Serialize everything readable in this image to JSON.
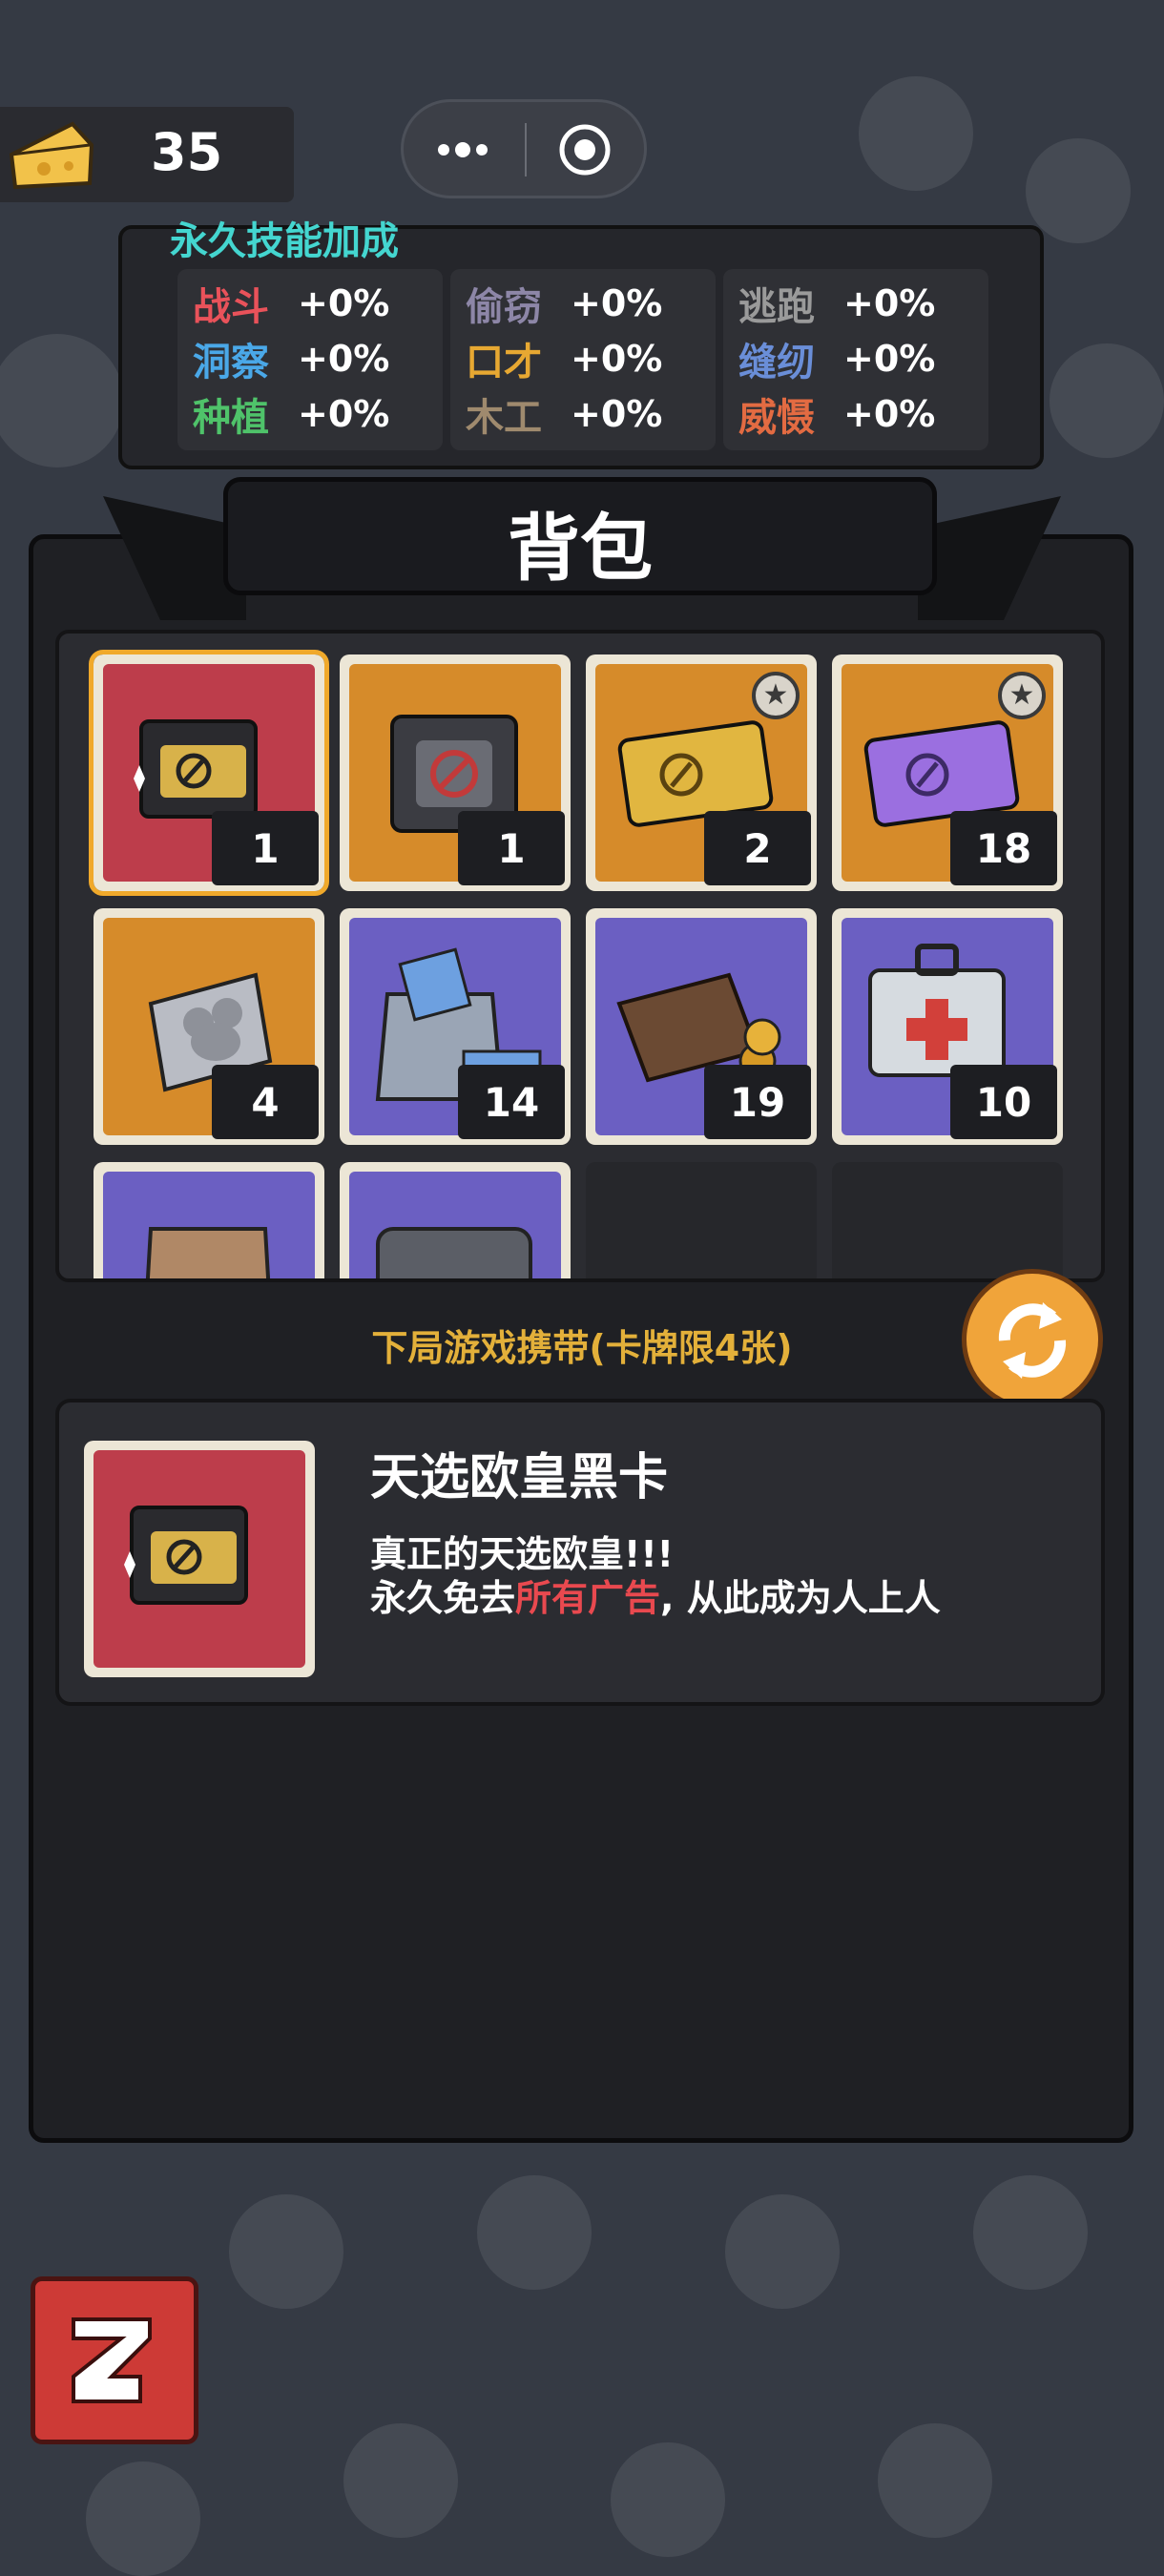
{
  "currency": {
    "icon": "cheese-icon",
    "amount": "35"
  },
  "capsule": {
    "more_icon": "more-icon",
    "close_icon": "target-icon"
  },
  "skills": {
    "title": "永久技能加成",
    "items": [
      {
        "name": "战斗",
        "value": "+0%",
        "color": "#e9525a"
      },
      {
        "name": "洞察",
        "value": "+0%",
        "color": "#4aa8e8"
      },
      {
        "name": "种植",
        "value": "+0%",
        "color": "#4fc36a"
      },
      {
        "name": "偷窃",
        "value": "+0%",
        "color": "#8d86a7"
      },
      {
        "name": "口才",
        "value": "+0%",
        "color": "#e7a832"
      },
      {
        "name": "木工",
        "value": "+0%",
        "color": "#9f8a6e"
      },
      {
        "name": "逃跑",
        "value": "+0%",
        "color": "#9a9a9a"
      },
      {
        "name": "缝纫",
        "value": "+0%",
        "color": "#6a8ed8"
      },
      {
        "name": "威慑",
        "value": "+0%",
        "color": "#e36b42"
      }
    ]
  },
  "backpack": {
    "title": "背包",
    "cards": [
      {
        "count": "1",
        "bg": "red",
        "icon": "black-card-box-icon",
        "selected": true
      },
      {
        "count": "1",
        "bg": "orange",
        "icon": "no-ads-pack-icon"
      },
      {
        "count": "2",
        "bg": "orange",
        "icon": "gold-ticket-icon",
        "star": true
      },
      {
        "count": "18",
        "bg": "orange",
        "icon": "purple-ticket-icon",
        "star": true
      },
      {
        "count": "4",
        "bg": "orange",
        "icon": "mouse-token-icon"
      },
      {
        "count": "14",
        "bg": "purple",
        "icon": "cash-bag-icon"
      },
      {
        "count": "19",
        "bg": "purple",
        "icon": "wallet-icon"
      },
      {
        "count": "10",
        "bg": "purple",
        "icon": "first-aid-kit-icon"
      },
      {
        "count": "",
        "bg": "purple",
        "icon": "paper-bag-icon"
      },
      {
        "count": "",
        "bg": "purple",
        "icon": "metal-case-icon"
      }
    ]
  },
  "carry_label": "下局游戏携带(卡牌限4张)",
  "detail": {
    "name": "天选欧皇黑卡",
    "line1": "真正的天选欧皇!!!",
    "line2_prefix": "永久免去",
    "line2_highlight": "所有广告",
    "line2_suffix": ", 从此成为人上人"
  },
  "back_icon": "back-arrow-icon"
}
